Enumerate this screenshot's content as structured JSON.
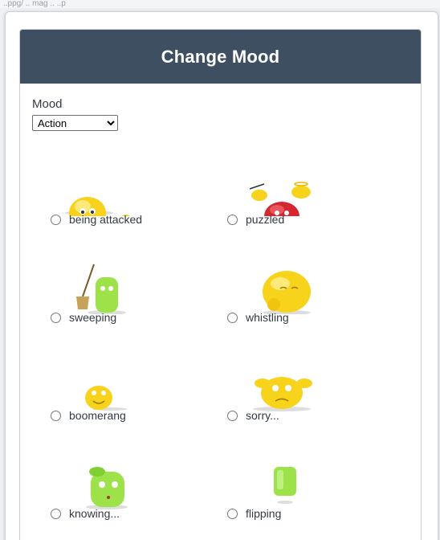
{
  "page": {
    "top_fragment": "..ppg/ .. mag .. ..p"
  },
  "dialog": {
    "title": "Change Mood",
    "mood_label": "Mood",
    "mood_select": {
      "selected": "Action"
    }
  },
  "moods": [
    {
      "label": "being attacked",
      "icon": "yellow-blob-with-ball-icon",
      "color": "#f7d31b"
    },
    {
      "label": "puzzled",
      "icon": "red-blob-with-devils-icon",
      "color": "#d6262f"
    },
    {
      "label": "sweeping",
      "icon": "green-blob-with-broom-icon",
      "color": "#9ee24a"
    },
    {
      "label": "whistling",
      "icon": "yellow-blob-whistling-icon",
      "color": "#f7d31b"
    },
    {
      "label": "boomerang",
      "icon": "small-yellow-blob-icon",
      "color": "#f7d31b"
    },
    {
      "label": "sorry...",
      "icon": "yellow-blob-sorry-icon",
      "color": "#f7d31b"
    },
    {
      "label": "knowing...",
      "icon": "green-blob-knowing-icon",
      "color": "#9ee24a"
    },
    {
      "label": "flipping",
      "icon": "green-blob-flipping-icon",
      "color": "#9ee24a"
    }
  ]
}
